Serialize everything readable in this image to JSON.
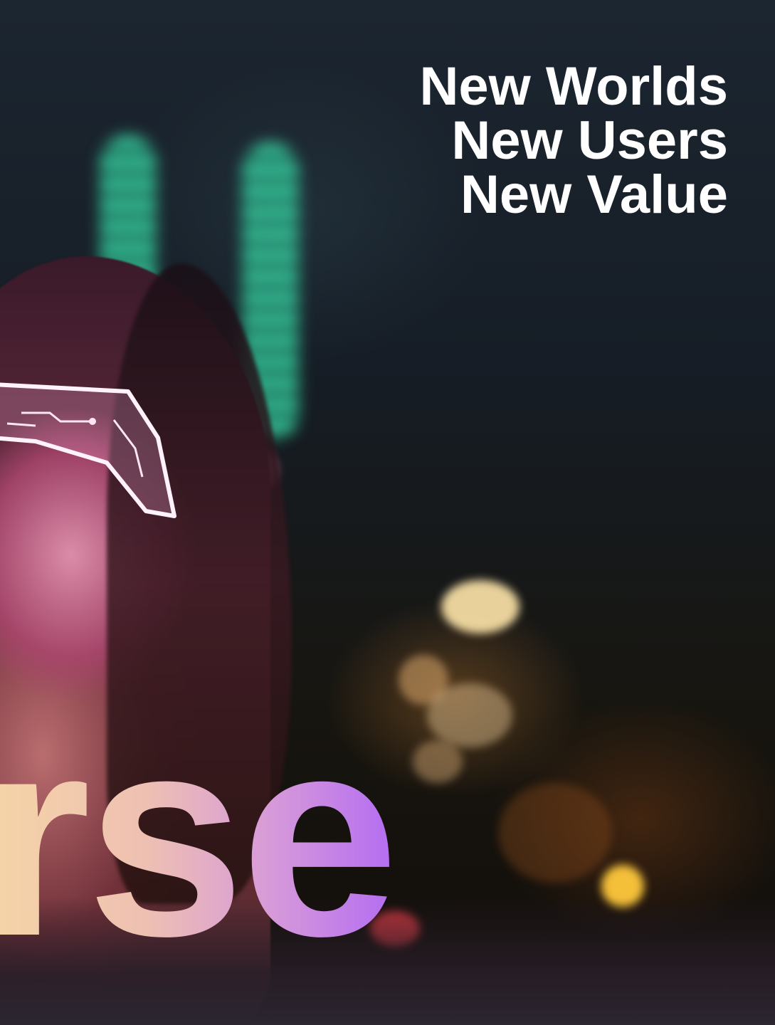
{
  "headline": {
    "lines": [
      "New Worlds",
      "New Users",
      "New Value"
    ]
  },
  "wordmark_fragment": "rse",
  "colors": {
    "headline_text": "#ffffff",
    "wordmark_gradient_start": "#f6d6a6",
    "wordmark_gradient_end": "#b36cf2",
    "background": "#161d26"
  },
  "photo": {
    "subject": "woman-wearing-glowing-visor",
    "setting": "night-city-bokeh"
  }
}
